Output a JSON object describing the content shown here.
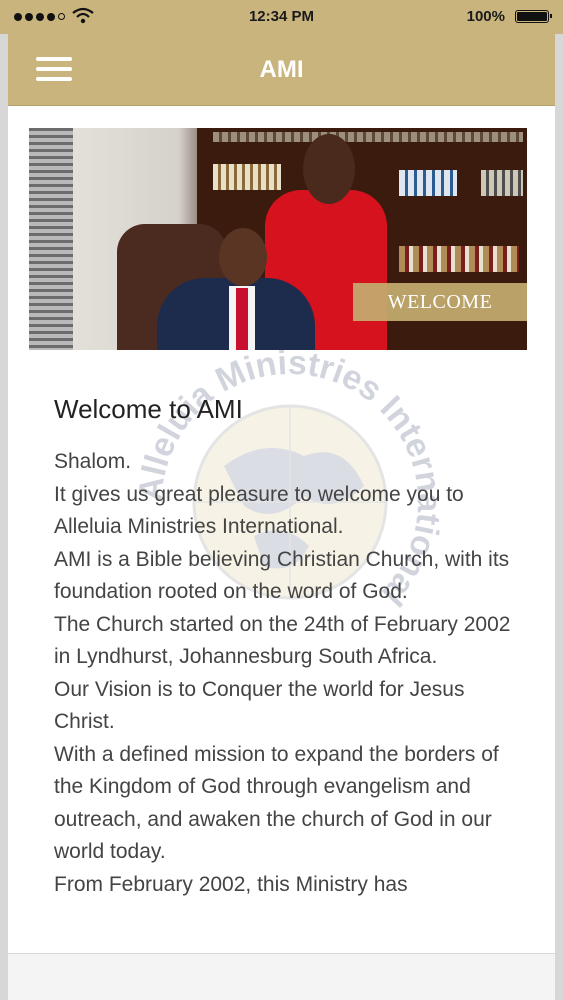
{
  "status_bar": {
    "time": "12:34 PM",
    "battery": "100%"
  },
  "navbar": {
    "title": "AMI"
  },
  "hero": {
    "tag": "WELCOME"
  },
  "main": {
    "heading": "Welcome to AMI",
    "paragraphs": [
      "Shalom.",
      "It gives us great pleasure to welcome you to Alleluia Ministries International.",
      "AMI is a Bible believing Christian Church, with its foundation rooted on the word of God.",
      "The Church started on the 24th of February 2002 in Lyndhurst, Johannesburg South Africa.",
      "Our Vision is to Conquer the world for Jesus Christ.",
      "With a defined mission to expand the borders of the Kingdom of God through evangelism and outreach, and awaken the church of God in our world today.",
      "From February 2002, this Ministry has"
    ]
  },
  "watermark_text": "Alleluia Ministries International",
  "colors": {
    "accent": "#c8b47c",
    "text": "#444444"
  }
}
